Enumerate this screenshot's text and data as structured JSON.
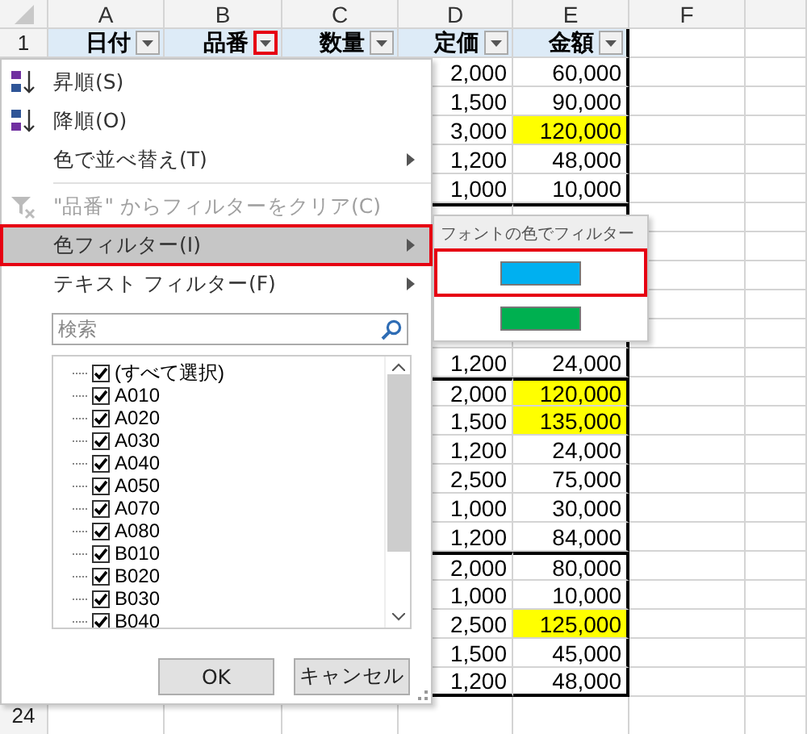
{
  "columns": [
    "A",
    "B",
    "C",
    "D",
    "E",
    "F"
  ],
  "header_row": {
    "number": "1",
    "cells": [
      {
        "label": "日付",
        "filter_annotated": false
      },
      {
        "label": "品番",
        "filter_annotated": true
      },
      {
        "label": "数量",
        "filter_annotated": false
      },
      {
        "label": "定価",
        "filter_annotated": false
      },
      {
        "label": "金額",
        "filter_annotated": false
      }
    ]
  },
  "rows_top": [
    {
      "price": "2,000",
      "amount": "60,000"
    },
    {
      "price": "1,500",
      "amount": "90,000"
    },
    {
      "price": "3,000",
      "amount": "120,000",
      "color": "#ffff00"
    },
    {
      "price": "1,200",
      "amount": "48,000"
    },
    {
      "price": "1,000",
      "amount": "10,000"
    }
  ],
  "rows_bottom": [
    {
      "price": "1,200",
      "amount": "24,000",
      "group_start": false
    },
    {
      "price": "2,000",
      "amount": "120,000",
      "color": "#ffff00",
      "group_start": true
    },
    {
      "price": "1,500",
      "amount": "135,000",
      "color": "#ffff00",
      "group_start": false
    },
    {
      "price": "1,200",
      "amount": "24,000",
      "group_start": false
    },
    {
      "price": "2,500",
      "amount": "75,000",
      "group_start": false
    },
    {
      "price": "1,000",
      "amount": "30,000",
      "group_start": false
    },
    {
      "price": "1,200",
      "amount": "84,000",
      "group_start": false
    },
    {
      "price": "2,000",
      "amount": "80,000",
      "group_start": true
    },
    {
      "price": "1,000",
      "amount": "10,000",
      "group_start": false
    },
    {
      "price": "2,500",
      "amount": "125,000",
      "color": "#ffff00",
      "group_start": false
    },
    {
      "price": "1,500",
      "amount": "45,000",
      "group_start": false
    },
    {
      "price": "1,200",
      "amount": "48,000",
      "group_start": false
    }
  ],
  "last_row_number": "24",
  "filter_menu": {
    "items": [
      {
        "kind": "sort_asc",
        "label": "昇順(S)",
        "disabled": false,
        "selected": false,
        "submenu": false,
        "annotated": false
      },
      {
        "kind": "sort_desc",
        "label": "降順(O)",
        "disabled": false,
        "selected": false,
        "submenu": false,
        "annotated": false
      },
      {
        "kind": "plain",
        "label": "色で並べ替え(T)",
        "disabled": false,
        "selected": false,
        "submenu": true,
        "annotated": false
      },
      {
        "kind": "separator"
      },
      {
        "kind": "clear",
        "label": "\"品番\" からフィルターをクリア(C)",
        "disabled": true,
        "selected": false,
        "submenu": false,
        "annotated": false
      },
      {
        "kind": "plain",
        "label": "色フィルター(I)",
        "disabled": false,
        "selected": true,
        "submenu": true,
        "annotated": true
      },
      {
        "kind": "plain",
        "label": "テキスト フィルター(F)",
        "disabled": false,
        "selected": false,
        "submenu": true,
        "annotated": false
      }
    ],
    "search": {
      "placeholder": "検索"
    },
    "values": [
      {
        "label": "(すべて選択)",
        "checked": true
      },
      {
        "label": "A010",
        "checked": true
      },
      {
        "label": "A020",
        "checked": true
      },
      {
        "label": "A030",
        "checked": true
      },
      {
        "label": "A040",
        "checked": true
      },
      {
        "label": "A050",
        "checked": true
      },
      {
        "label": "A070",
        "checked": true
      },
      {
        "label": "A080",
        "checked": true
      },
      {
        "label": "B010",
        "checked": true
      },
      {
        "label": "B020",
        "checked": true
      },
      {
        "label": "B030",
        "checked": true
      },
      {
        "label": "B040",
        "checked": true
      }
    ],
    "buttons": [
      "OK",
      "キャンセル"
    ]
  },
  "color_submenu": {
    "title": "フォントの色でフィルター",
    "swatches": [
      {
        "color": "#00b0f0",
        "annotated": true
      },
      {
        "color": "#00b050",
        "annotated": false
      }
    ]
  }
}
